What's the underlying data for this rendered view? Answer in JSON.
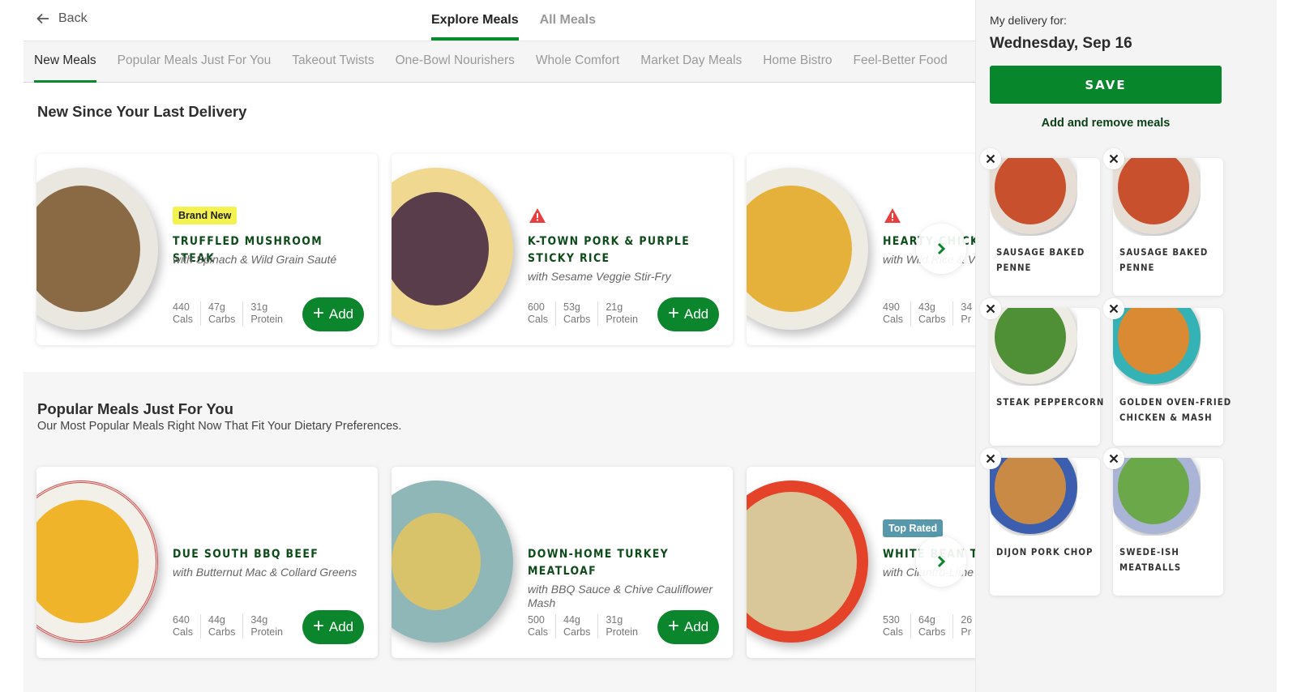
{
  "topbar": {
    "back_label": "Back",
    "view_tabs": [
      {
        "label": "Explore Meals",
        "active": true
      },
      {
        "label": "All Meals",
        "active": false
      }
    ]
  },
  "categories": [
    {
      "label": "New Meals",
      "active": true
    },
    {
      "label": "Popular Meals Just For You",
      "active": false
    },
    {
      "label": "Takeout Twists",
      "active": false
    },
    {
      "label": "One-Bowl Nourishers",
      "active": false
    },
    {
      "label": "Whole Comfort",
      "active": false
    },
    {
      "label": "Market Day Meals",
      "active": false
    },
    {
      "label": "Home Bistro",
      "active": false
    },
    {
      "label": "Feel-Better Food",
      "active": false
    }
  ],
  "sections": [
    {
      "title": "New Since Your Last Delivery",
      "subtitle": "",
      "meals": [
        {
          "badge": "Brand New",
          "badge_type": "brand-new",
          "warning": false,
          "name": "TRUFFLED MUSHROOM STEAK",
          "sub": "with Spinach & Wild Grain Sauté",
          "cals": "440",
          "cals_label": "Cals",
          "carbs": "47g",
          "carbs_label": "Carbs",
          "protein": "31g",
          "protein_label": "Protein",
          "add_label": "Add",
          "plate_color": "#e9e7df",
          "food_color": "#8a6a45"
        },
        {
          "badge": "",
          "badge_type": "",
          "warning": true,
          "name": "K-TOWN PORK & PURPLE STICKY RICE",
          "sub": "with Sesame Veggie Stir-Fry",
          "cals": "600",
          "cals_label": "Cals",
          "carbs": "53g",
          "carbs_label": "Carbs",
          "protein": "21g",
          "protein_label": "Protein",
          "add_label": "Add",
          "plate_color": "#f0d891",
          "food_color": "#5a3d4a"
        },
        {
          "badge": "",
          "badge_type": "",
          "warning": true,
          "name": "HEARTY CHICKEN",
          "sub": "with Wild Rice & V",
          "cals": "490",
          "cals_label": "Cals",
          "carbs": "43g",
          "carbs_label": "Carbs",
          "protein": "34",
          "protein_label": "Pr",
          "add_label": "Add",
          "plate_color": "#eeebe2",
          "food_color": "#e6b13a"
        }
      ]
    },
    {
      "title": "Popular Meals Just For You",
      "subtitle": "Our Most Popular Meals Right Now That Fit Your Dietary Preferences.",
      "meals": [
        {
          "badge": "",
          "badge_type": "",
          "warning": false,
          "name": "DUE SOUTH BBQ BEEF",
          "sub": "with Butternut Mac & Collard Greens",
          "cals": "640",
          "cals_label": "Cals",
          "carbs": "44g",
          "carbs_label": "Carbs",
          "protein": "34g",
          "protein_label": "Protein",
          "add_label": "Add",
          "plate_color": "#f3efe9",
          "food_color": "#f0b42a"
        },
        {
          "badge": "",
          "badge_type": "",
          "warning": false,
          "name": "DOWN-HOME TURKEY MEATLOAF",
          "sub": "with BBQ Sauce & Chive Cauliflower Mash",
          "cals": "500",
          "cals_label": "Cals",
          "carbs": "44g",
          "carbs_label": "Carbs",
          "protein": "31g",
          "protein_label": "Protein",
          "add_label": "Add",
          "plate_color": "#8fb7b8",
          "food_color": "#d8c36a"
        },
        {
          "badge": "Top Rated",
          "badge_type": "top-rated",
          "warning": false,
          "name": "WHITE BEAN TU",
          "sub": "with Cilantro-Lime",
          "cals": "530",
          "cals_label": "Cals",
          "carbs": "64g",
          "carbs_label": "Carbs",
          "protein": "26",
          "protein_label": "Pr",
          "add_label": "Add",
          "plate_color": "#e4432a",
          "food_color": "#d9c79a"
        }
      ]
    }
  ],
  "sidebar": {
    "delivery_label": "My delivery for:",
    "delivery_date": "Wednesday, Sep 16",
    "save_label": "SAVE",
    "add_remove_label": "Add and remove meals",
    "selected_meals": [
      {
        "name": "SAUSAGE BAKED PENNE",
        "plate_color": "#e6ddd4",
        "food_color": "#c8502c"
      },
      {
        "name": "SAUSAGE BAKED PENNE",
        "plate_color": "#e6ddd4",
        "food_color": "#c8502c"
      },
      {
        "name": "STEAK PEPPERCORN",
        "plate_color": "#eeeae4",
        "food_color": "#4f8f35"
      },
      {
        "name": "GOLDEN OVEN-FRIED CHICKEN & MASH",
        "plate_color": "#35b2b5",
        "food_color": "#d98a32"
      },
      {
        "name": "DIJON PORK CHOP",
        "plate_color": "#3b5fae",
        "food_color": "#c98a45"
      },
      {
        "name": "SWEDE-ISH MEATBALLS",
        "plate_color": "#a9b4d6",
        "food_color": "#6aa84a"
      }
    ]
  },
  "colors": {
    "brand_green": "#0b862c",
    "title_green": "#0d4b19",
    "warning_red": "#e84040",
    "badge_yellow": "#f4f24f",
    "badge_blue": "#5898ad"
  }
}
